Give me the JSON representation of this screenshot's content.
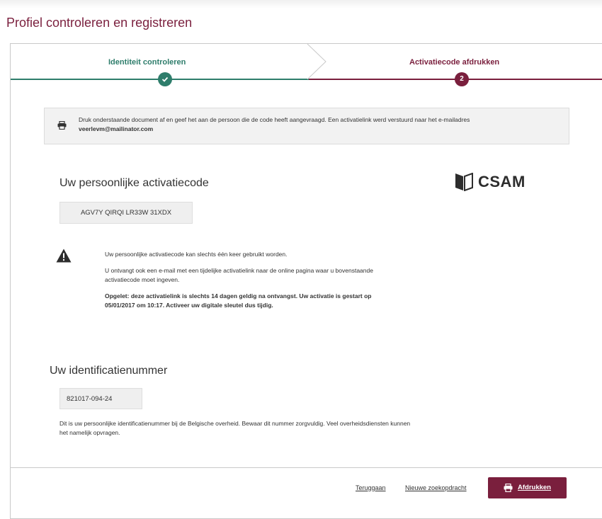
{
  "page_title": "Profiel controleren en registreren",
  "steps": [
    {
      "label": "Identiteit controleren",
      "marker": "check-icon",
      "color": "#2e7d6b"
    },
    {
      "label": "Activatiecode afdrukken",
      "marker": "2",
      "color": "#7a1f3d"
    }
  ],
  "info": {
    "text": "Druk onderstaande document af en geef het aan de persoon die de code heeft aangevraagd. Een activatielink werd verstuurd naar het e-mailadres",
    "email": "veerlevm@mailinator.com",
    "icon": "printer-icon"
  },
  "activation": {
    "title": "Uw persoonlijke activatiecode",
    "code": "AGV7Y QIRQI LR33W 31XDX",
    "logo_text": "CSAM"
  },
  "warning": {
    "icon": "warning-icon",
    "line1": "Uw persoonlijke activatiecode kan slechts één keer gebruikt worden.",
    "line2": "U ontvangt ook een e-mail met een tijdelijke activatielink naar de online pagina waar u bovenstaande activatiecode moet ingeven.",
    "line3": "Opgelet: deze activatielink is slechts 14 dagen geldig na ontvangst. Uw activatie is gestart op 05/01/2017 om 10:17. Activeer uw digitale sleutel dus tijdig."
  },
  "identification": {
    "title": "Uw identificatienummer",
    "number": "821017-094-24",
    "description": "Dit is uw persoonlijke identificatienummer bij de Belgische overheid. Bewaar dit nummer zorgvuldig. Veel overheidsdiensten kunnen het namelijk opvragen."
  },
  "footer": {
    "back_label": "Teruggaan",
    "new_search_label": "Nieuwe zoekopdracht",
    "print_label": "Afdrukken"
  },
  "colors": {
    "accent": "#7a1f3d",
    "success": "#2e7d6b"
  }
}
